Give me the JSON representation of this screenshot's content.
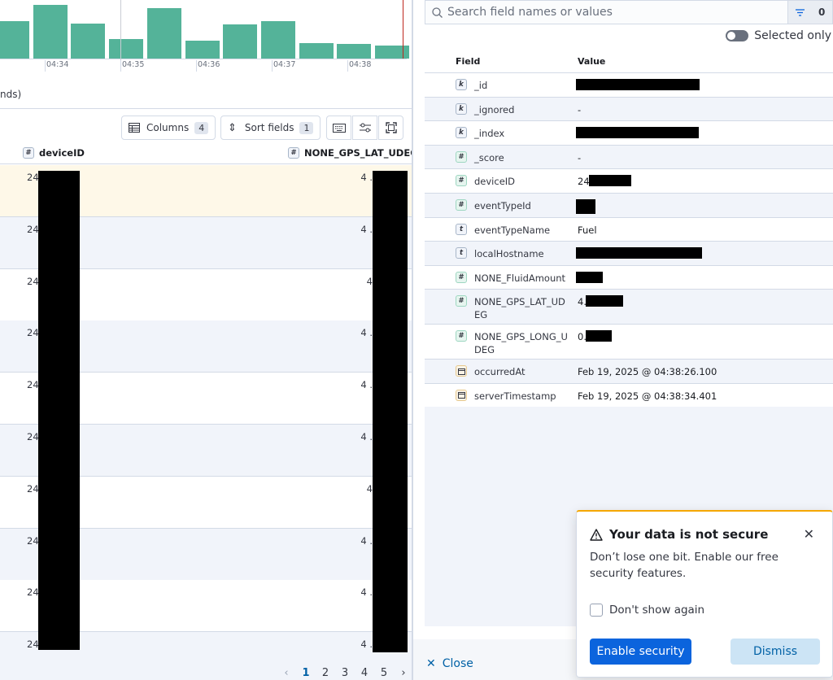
{
  "histogram": {
    "chart_data": {
      "type": "bar",
      "x_tick_labels": [
        "04:34",
        "04:35",
        "04:36",
        "04:37",
        "04:38"
      ],
      "values": [
        38,
        55,
        36,
        20,
        52,
        18,
        35,
        38,
        16,
        15,
        13
      ]
    },
    "interval_text": "nds)"
  },
  "toolbar": {
    "columns_label": "Columns",
    "columns_count": "4",
    "sort_label": "Sort fields",
    "sort_count": "1"
  },
  "grid": {
    "col_device": "deviceID",
    "col_lat": "NONE_GPS_LAT_UDEG",
    "rows": [
      {
        "c1": "24",
        "c2": "4 ."
      },
      {
        "c1": "24",
        "c2": "4 ."
      },
      {
        "c1": "24",
        "c2": "4"
      },
      {
        "c1": "24",
        "c2": "4 ."
      },
      {
        "c1": "24",
        "c2": "4 ."
      },
      {
        "c1": "24",
        "c2": "4 ."
      },
      {
        "c1": "24",
        "c2": "4"
      },
      {
        "c1": "24",
        "c2": "4 ."
      },
      {
        "c1": "24",
        "c2": "4 ."
      },
      {
        "c1": "24",
        "c2": "4 ."
      }
    ]
  },
  "pagination": {
    "prev": "‹",
    "pages": [
      "1",
      "2",
      "3",
      "4",
      "5"
    ],
    "next": "›"
  },
  "flyout": {
    "search_placeholder": "Search field names or values",
    "filter_count": "0",
    "selected_only_label": "Selected only",
    "header_field": "Field",
    "header_value": "Value",
    "rows": [
      {
        "type": "k",
        "name": "_id",
        "value": ""
      },
      {
        "type": "k",
        "name": "_ignored",
        "value": "-"
      },
      {
        "type": "k",
        "name": "_index",
        "value": ""
      },
      {
        "type": "#",
        "name": "_score",
        "value": "-"
      },
      {
        "type": "#",
        "name": "deviceID",
        "value": "24"
      },
      {
        "type": "#",
        "name": "eventTypeId",
        "value": ""
      },
      {
        "type": "t",
        "name": "eventTypeName",
        "value": "Fuel"
      },
      {
        "type": "t",
        "name": "localHostname",
        "value": ""
      },
      {
        "type": "#",
        "name": "NONE_FluidAmount",
        "value": ""
      },
      {
        "type": "#",
        "name": "NONE_GPS_LAT_UDEG",
        "value": "4."
      },
      {
        "type": "#",
        "name": "NONE_GPS_LONG_UDEG",
        "value": "0."
      },
      {
        "type": "date",
        "name": "occurredAt",
        "value": "Feb 19, 2025 @ 04:38:26.100"
      },
      {
        "type": "date",
        "name": "serverTimestamp",
        "value": "Feb 19, 2025 @ 04:38:34.401"
      }
    ],
    "close_label": "Close"
  },
  "toast": {
    "title": "Your data is not secure",
    "body": "Don’t lose one bit. Enable our free security features.",
    "checkbox_label": "Don't show again",
    "enable_label": "Enable security",
    "dismiss_label": "Dismiss"
  },
  "colors": {
    "bar": "#54b399",
    "primary": "#0b64dd",
    "warning": "#f5a700",
    "highlight_row": "#fef8e8",
    "alt_row": "#f1f4fa"
  }
}
